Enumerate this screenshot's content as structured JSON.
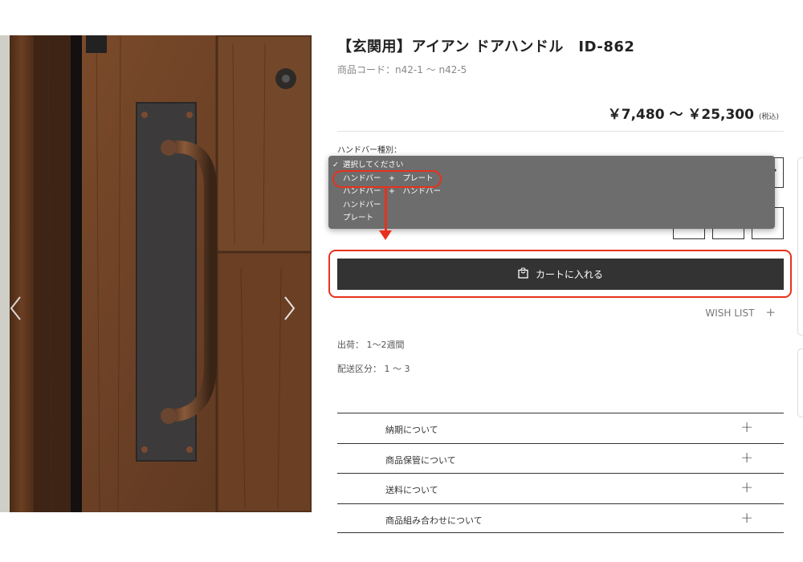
{
  "product": {
    "title": "【玄関用】アイアン ドアハンドル　ID-862",
    "code": "商品コード：n42-1 〜 n42-5",
    "price": "￥7,480 〜 ￥25,300",
    "tax_note": "(税込)"
  },
  "option": {
    "label": "ハンドバー種別：",
    "dropdown": {
      "placeholder": "選択してください",
      "check_glyph": "✓",
      "items": [
        "ハンドバー　+　プレート",
        "ハンドバー　+　ハンドバー",
        "ハンドバー",
        "プレート"
      ],
      "highlighted_index": 0
    }
  },
  "cart_button": {
    "label": "カートに入れる",
    "icon": "shopping-bag-icon"
  },
  "wishlist": {
    "label": "WISH LIST",
    "plus": "+"
  },
  "shipping": {
    "lead_time": "出荷： 1〜2週間",
    "class": "配送区分： 1 〜 3"
  },
  "accordion": [
    {
      "label": "納期について",
      "icon": "+"
    },
    {
      "label": "商品保管について",
      "icon": "+"
    },
    {
      "label": "送料について",
      "icon": "+"
    },
    {
      "label": "商品組み合わせについて",
      "icon": "+"
    }
  ],
  "gallery": {
    "prev_icon": "chevron-left-icon",
    "next_icon": "chevron-right-icon"
  },
  "colors": {
    "annotation": "#e8311c",
    "button": "#333333",
    "dropdown_bg": "#6d6d6d"
  }
}
